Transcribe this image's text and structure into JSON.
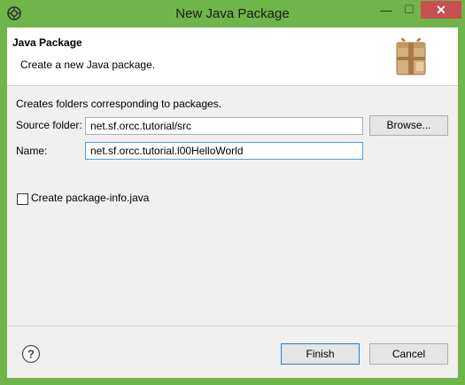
{
  "window": {
    "title": "New Java Package",
    "controls": {
      "minimize": "—",
      "maximize": "☐",
      "close": "✕"
    }
  },
  "banner": {
    "title": "Java Package",
    "description": "Create a new Java package."
  },
  "form": {
    "intro": "Creates folders corresponding to packages.",
    "source_folder": {
      "label": "Source folder:",
      "value": "net.sf.orcc.tutorial/src"
    },
    "browse_label": "Browse...",
    "name": {
      "label": "Name:",
      "value": "net.sf.orcc.tutorial.l00HelloWorld"
    },
    "package_info": {
      "label": "Create package-info.java",
      "checked": false
    }
  },
  "footer": {
    "help_icon": "question-circle-icon",
    "finish_label": "Finish",
    "cancel_label": "Cancel"
  },
  "colors": {
    "title_bar": "#6fb54a",
    "close_button": "#c74f4f",
    "focus_border": "#569de5"
  }
}
